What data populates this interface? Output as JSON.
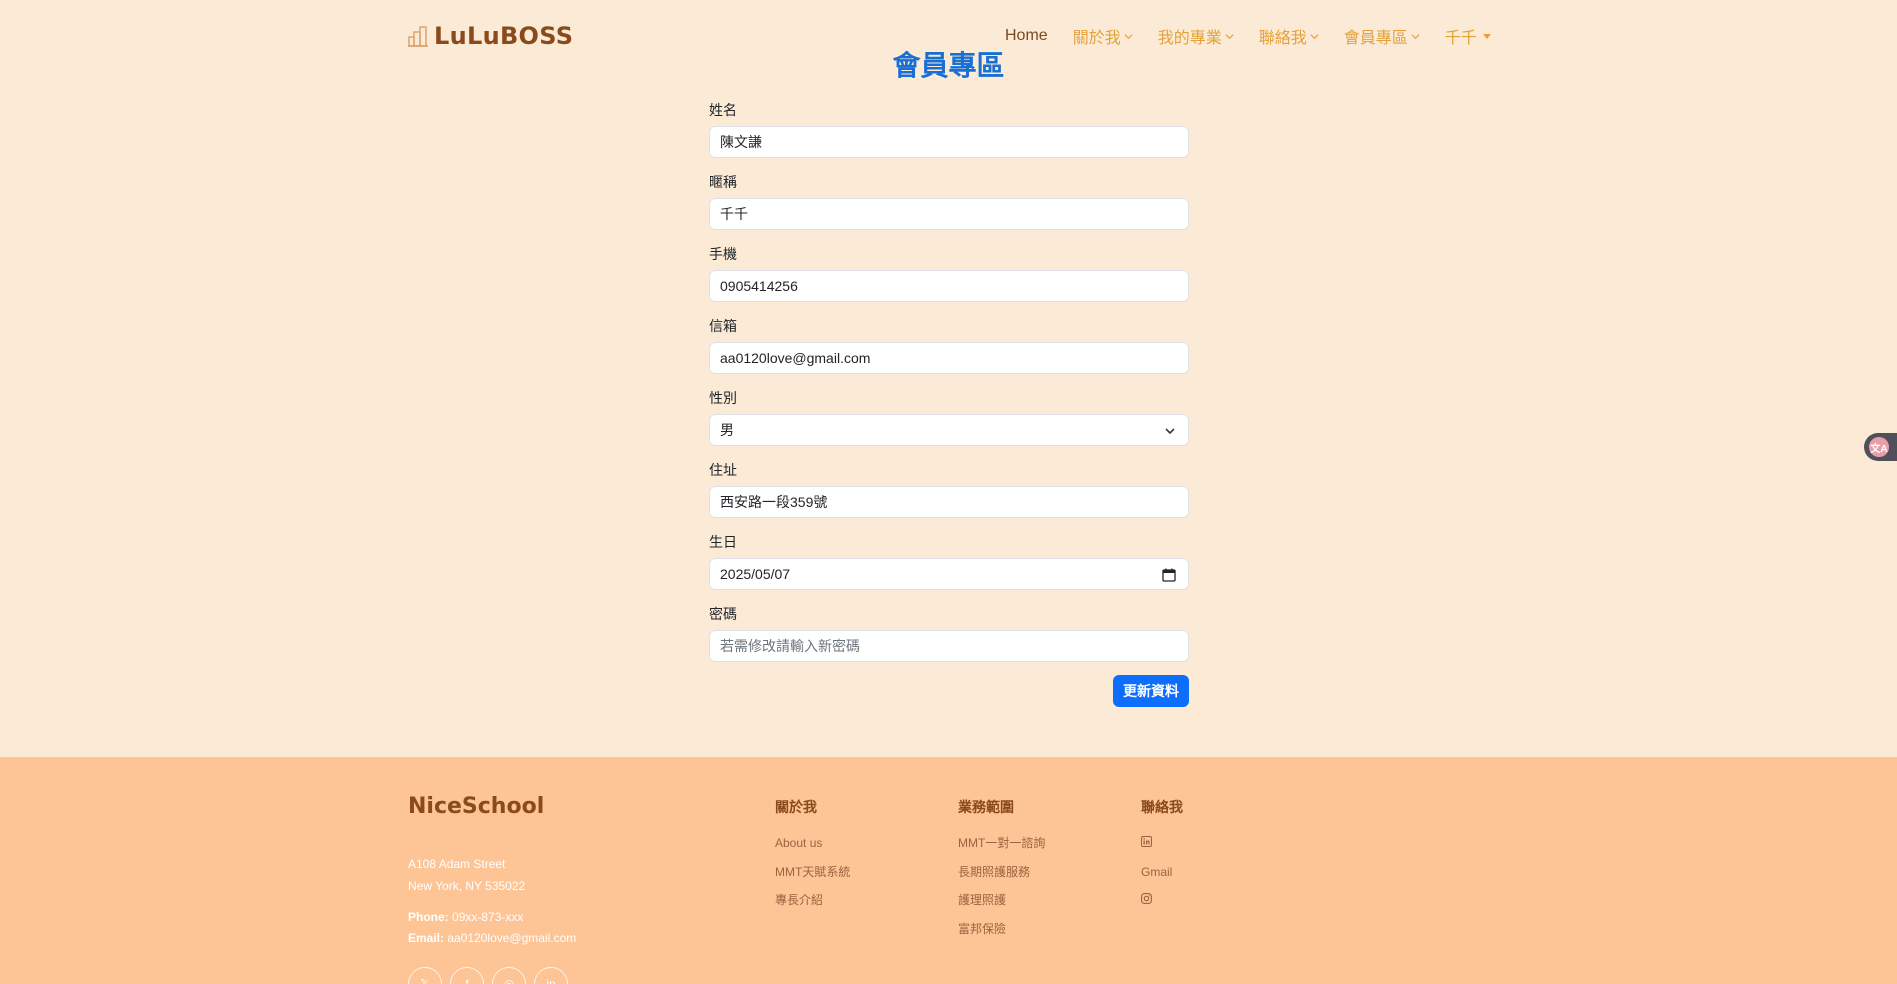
{
  "brand": "LuLuBOSS",
  "nav": {
    "home": "Home",
    "about": "關於我",
    "projects": "我的專業",
    "contact": "聯絡我",
    "member": "會員專區",
    "user": "千千"
  },
  "page_title": "會員專區",
  "form": {
    "name_label": "姓名",
    "name_value": "陳文謙",
    "nickname_label": "暱稱",
    "nickname_value": "千千",
    "phone_label": "手機",
    "phone_value": "0905414256",
    "email_label": "信箱",
    "email_value": "aa0120love@gmail.com",
    "gender_label": "性別",
    "gender_value": "男",
    "address_label": "住址",
    "address_value": "西安路一段359號",
    "birthday_label": "生日",
    "birthday_value": "2025/05/07",
    "password_label": "密碼",
    "password_placeholder": "若需修改請輸入新密碼",
    "submit_label": "更新資料"
  },
  "translate_widget": "文A",
  "footer": {
    "brand": "NiceSchool",
    "address_line1": "A108 Adam Street",
    "address_line2": "New York, NY 535022",
    "phone_label": "Phone:",
    "phone_value": "09xx-873-xxx",
    "email_label": "Email:",
    "email_value": "aa0120love@gmail.com",
    "about": {
      "heading": "關於我",
      "links": [
        "About us",
        "MMT天賦系統",
        "專長介紹"
      ]
    },
    "services": {
      "heading": "業務範圍",
      "links": [
        "MMT一對一諮詢",
        "長期照護服務",
        "護理照護",
        "富邦保險"
      ]
    },
    "contact": {
      "heading": "聯絡我",
      "gmail": "Gmail"
    }
  },
  "colors": {
    "background": "#fbebd6",
    "footer": "#fdc495",
    "accent": "#e4a13a",
    "brand": "#8a4a1a",
    "title": "#1a6fd4",
    "button": "#0d6efd"
  }
}
